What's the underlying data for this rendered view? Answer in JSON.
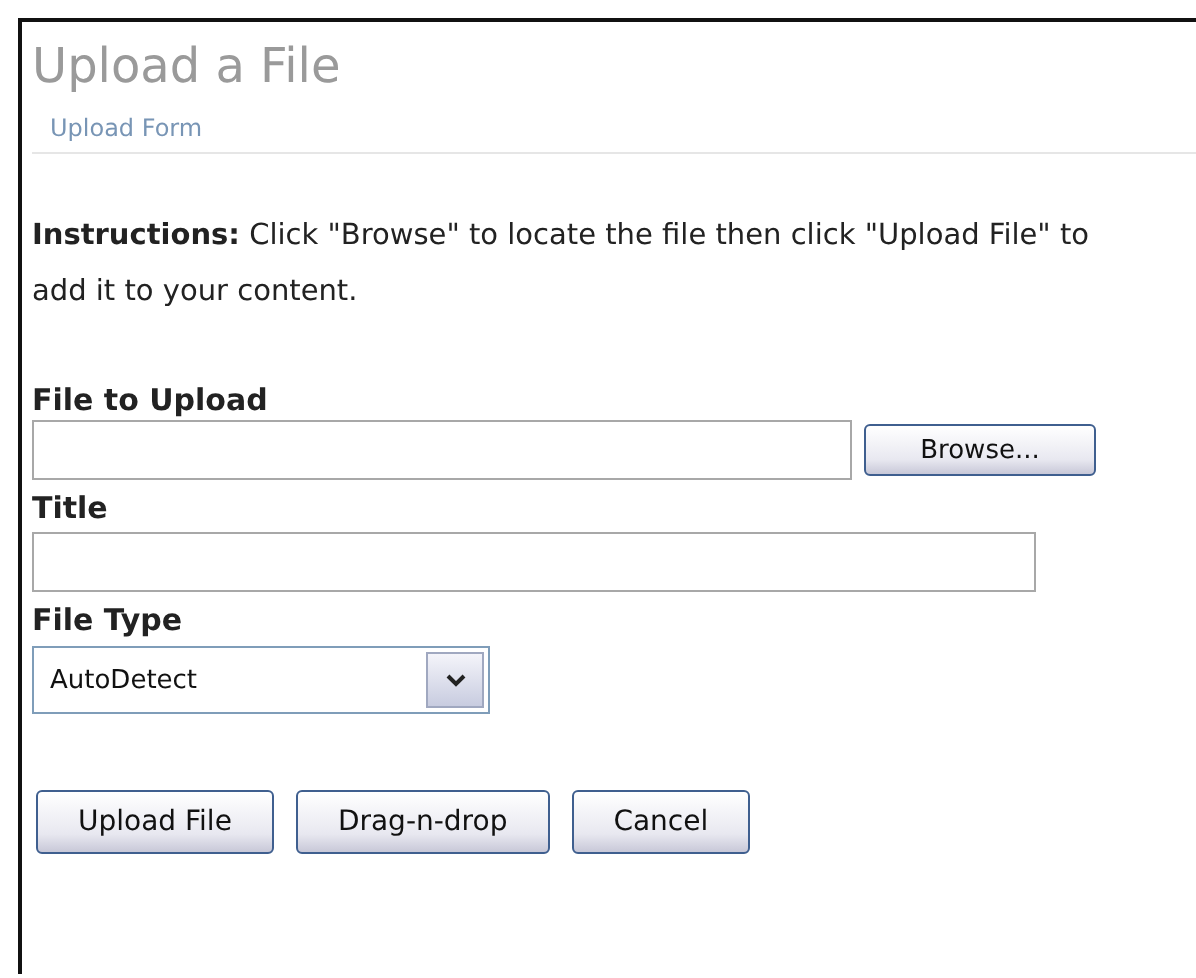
{
  "page": {
    "title": "Upload a File",
    "breadcrumb": "Upload Form"
  },
  "instructions": "**Instructions:** Click \"Browse\" to locate the file then click \"Upload File\" to add it to your content.",
  "fields": [
    {
      "kind": "file",
      "label": "File to Upload",
      "button": "Browse..."
    },
    {
      "kind": "text",
      "label": "Title"
    },
    {
      "kind": "select",
      "label": "File Type",
      "value": "AutoDetect"
    }
  ],
  "buttons": [
    "Upload File",
    "Drag-n-drop",
    "Cancel"
  ]
}
